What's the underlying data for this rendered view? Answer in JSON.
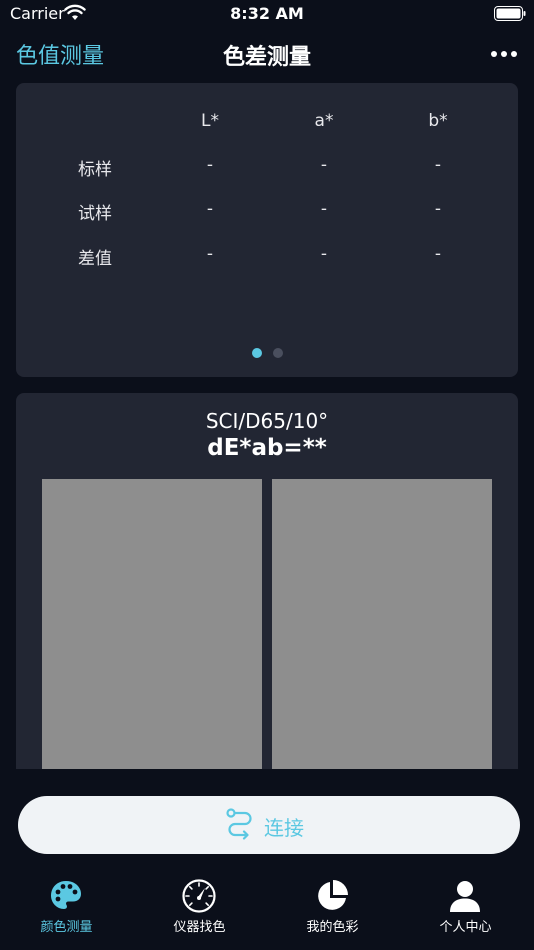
{
  "status_bar": {
    "carrier": "Carrier",
    "time": "8:32 AM"
  },
  "nav": {
    "back_label": "色值测量",
    "title": "色差测量",
    "more_icon": "ellipsis-icon"
  },
  "table": {
    "columns": [
      "L*",
      "a*",
      "b*"
    ],
    "rows": [
      {
        "label": "标样",
        "values": [
          "-",
          "-",
          "-"
        ]
      },
      {
        "label": "试样",
        "values": [
          "-",
          "-",
          "-"
        ]
      },
      {
        "label": "差值",
        "values": [
          "-",
          "-",
          "-"
        ]
      }
    ],
    "page_count": 2,
    "active_page": 1
  },
  "compare": {
    "condition": "SCI/D65/10°",
    "delta_e": "dE*ab=**",
    "standard_color": "#8e8e8e",
    "sample_color": "#8e8e8e"
  },
  "connect": {
    "label": "连接",
    "icon": "route-icon"
  },
  "tabs": [
    {
      "label": "颜色测量",
      "icon": "palette-icon",
      "active": true
    },
    {
      "label": "仪器找色",
      "icon": "gauge-icon",
      "active": false
    },
    {
      "label": "我的色彩",
      "icon": "pie-chart-icon",
      "active": false
    },
    {
      "label": "个人中心",
      "icon": "user-icon",
      "active": false
    }
  ],
  "colors": {
    "accent": "#5bc8e2",
    "background": "#0b0f1a",
    "card": "#222633"
  }
}
